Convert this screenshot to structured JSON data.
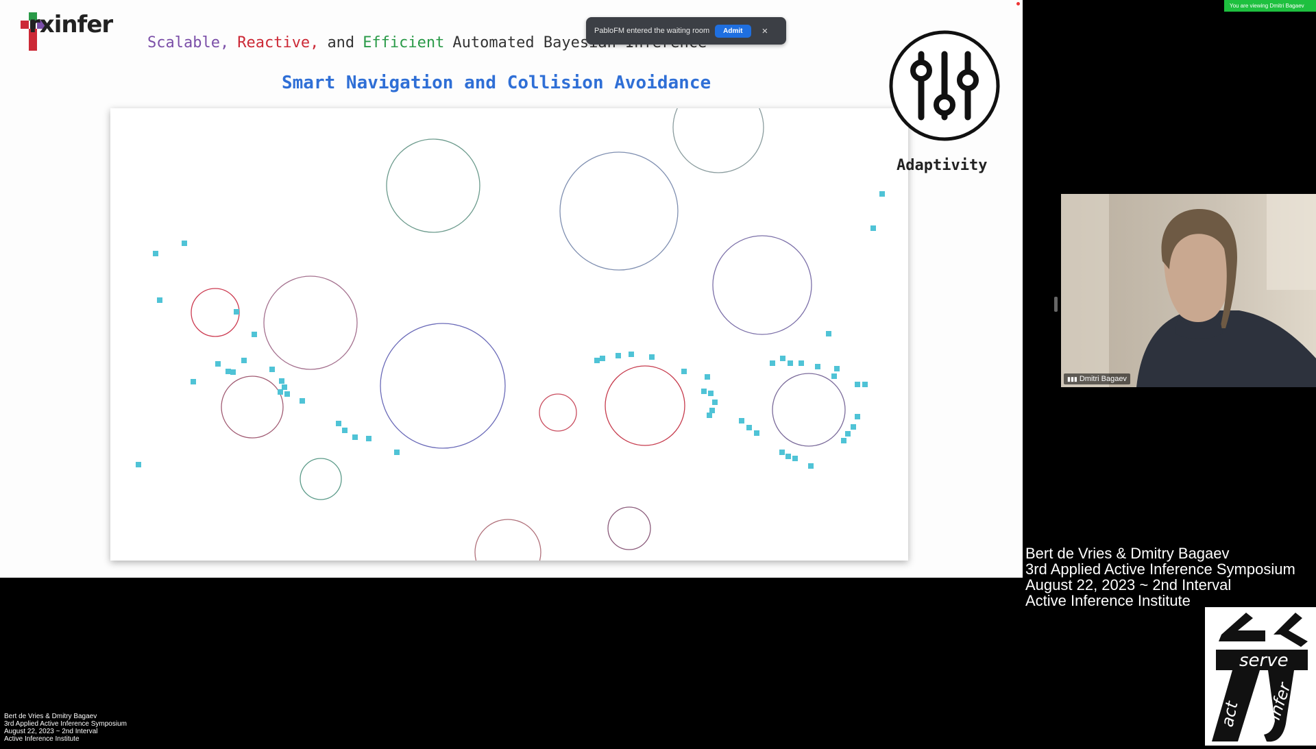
{
  "slide": {
    "logo_text": "rxinfer",
    "tagline": {
      "word1": "Scalable,",
      "word2": "Reactive,",
      "word3": "and",
      "word4": "Efficient",
      "rest": "Automated Bayesian Inference"
    },
    "title": "Smart Navigation and Collision Avoidance",
    "adaptivity_label": "Adaptivity",
    "colors": {
      "scalable": "#7b4fa8",
      "reactive": "#cc2936",
      "efficient": "#2a9a48",
      "title": "#2f6fd6",
      "agent_dots": "#4fc3d6"
    }
  },
  "notification": {
    "message": "PabloFM entered the waiting room",
    "admit_label": "Admit",
    "close_icon": "×"
  },
  "viewing_badge": "You are viewing Dmitri Bagaev",
  "video": {
    "participant_name": "Dmitri Bagaev",
    "signal_icon": "signal-bars-icon"
  },
  "credits": {
    "line1": "Bert de Vries & Dmitry Bagaev",
    "line2": "3rd Applied Active Inference Symposium",
    "line3": "August 22, 2023 ~ 2nd Interval",
    "line4": "Active Inference Institute"
  },
  "institute_logo": {
    "word_top": "serve",
    "word_left": "act",
    "word_right": "infer"
  }
}
